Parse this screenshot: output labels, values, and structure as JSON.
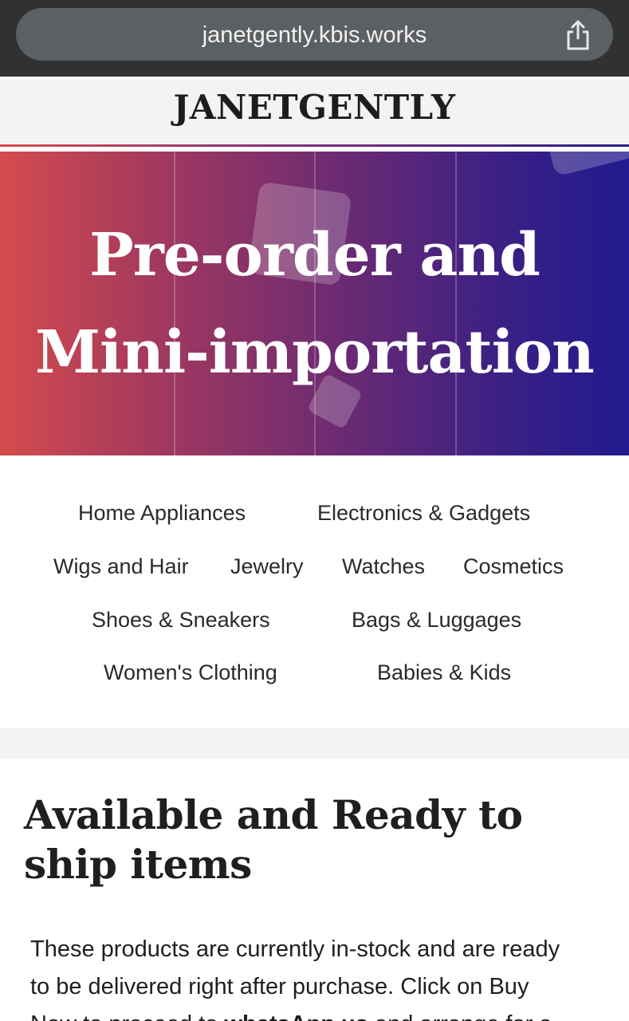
{
  "browser": {
    "url": "janetgently.kbis.works",
    "share_icon": "share-icon"
  },
  "site": {
    "title": "JANETGENTLY"
  },
  "hero": {
    "line1": "Pre-order and",
    "line2": "Mini-importation"
  },
  "categories": [
    "Home Appliances",
    "Electronics & Gadgets",
    "Wigs and Hair",
    "Jewelry",
    "Watches",
    "Cosmetics",
    "Shoes & Sneakers",
    "Bags & Luggages",
    "Women's Clothing",
    "Babies & Kids"
  ],
  "section": {
    "title_line1": "Available and Ready to",
    "title_line2": "ship items",
    "body_line1": "These products are currently in-stock and are ready",
    "body_line2": "to be delivered right after purchase. Click on Buy",
    "body_line3_start": "Now to proceed to ",
    "body_line3_bold": "whatsApp us",
    "body_line3_end": " and arrange for a"
  },
  "colors": {
    "hero_start": "#d44b4c",
    "hero_end": "#221a8f",
    "header_bg": "#f2f3f5",
    "browser_bg": "#2f3133"
  }
}
